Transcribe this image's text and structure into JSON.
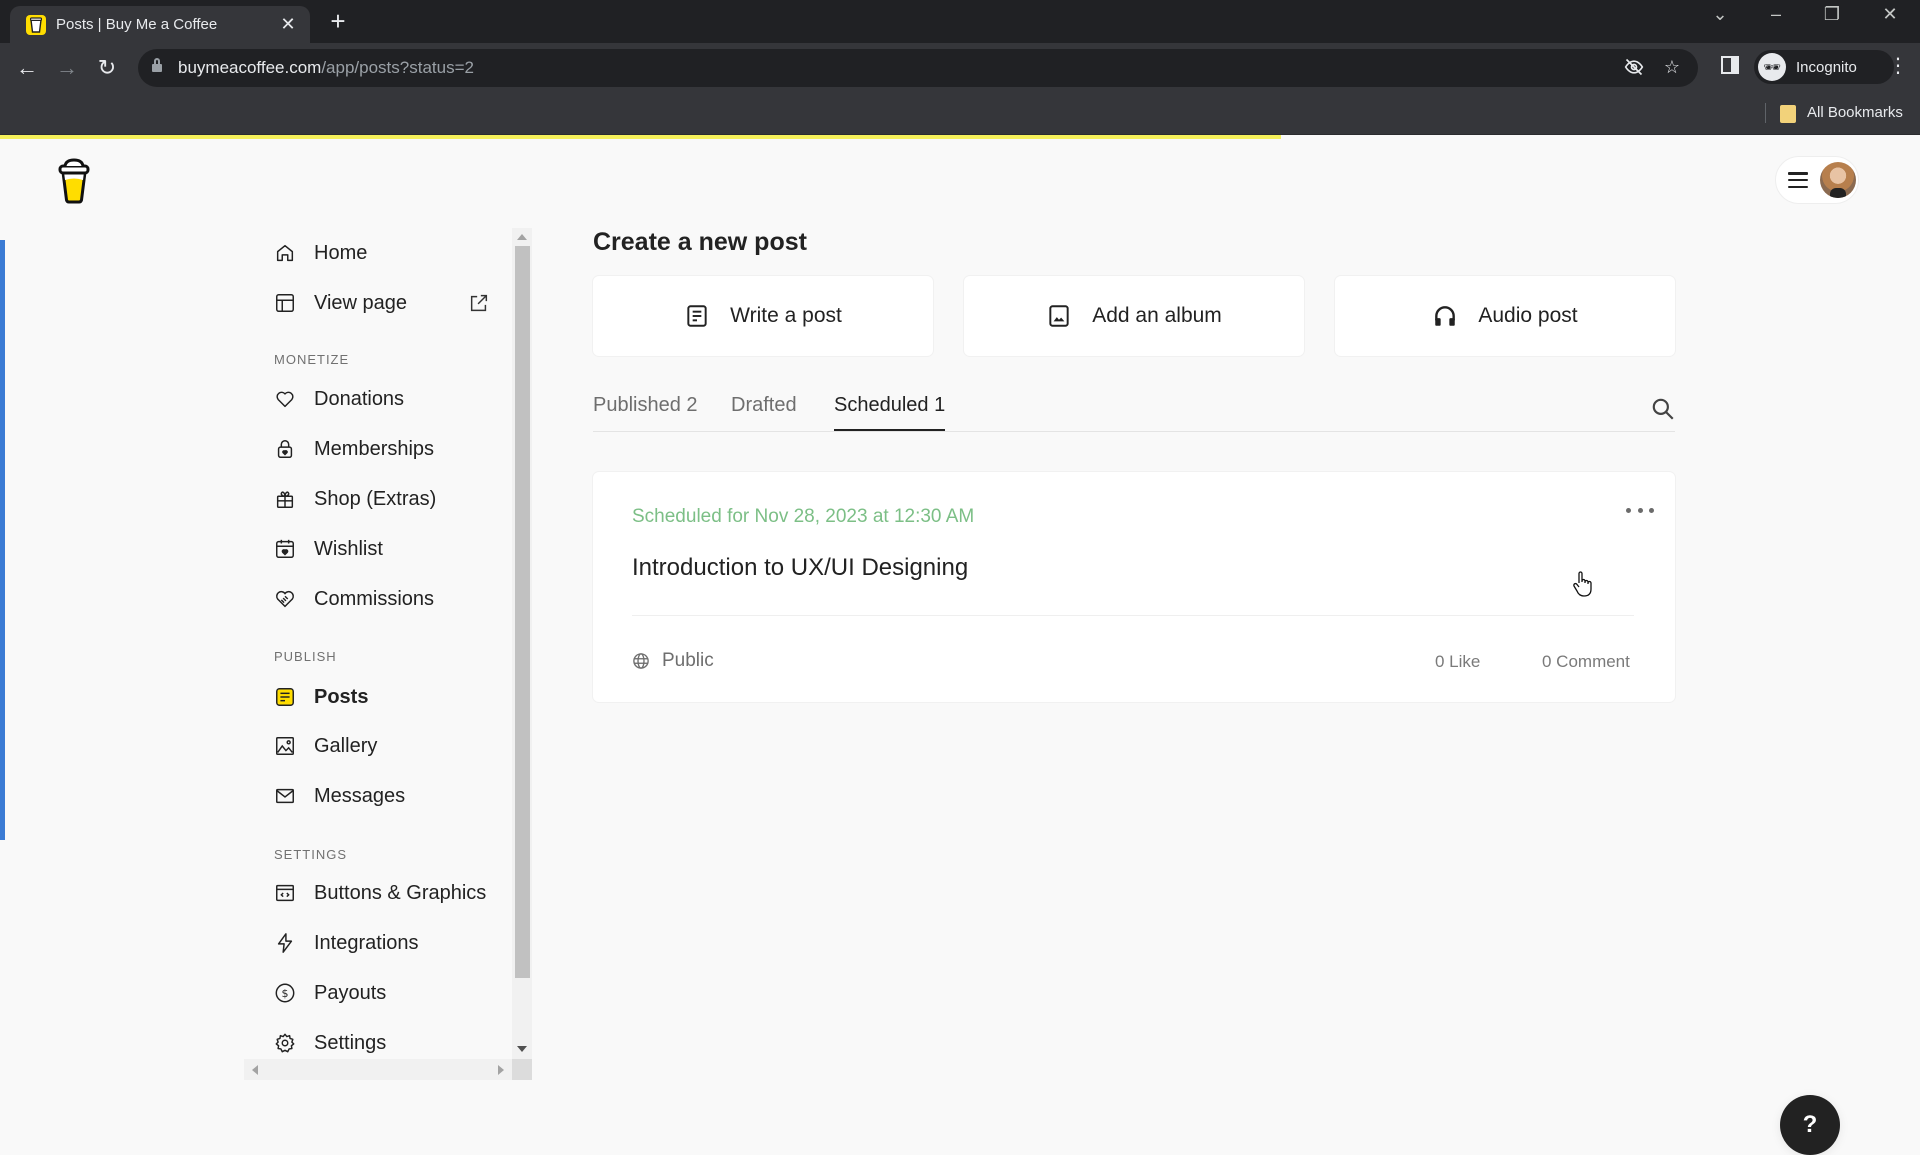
{
  "browser": {
    "tab_title": "Posts | Buy Me a Coffee",
    "url_host": "buymeacoffee.com",
    "url_path": "/app/posts?status=2",
    "profile_label": "Incognito",
    "bookmarks_label": "All Bookmarks",
    "page_load_progress_percent": 66.7
  },
  "sidebar": {
    "top_items": [
      {
        "label": "Home",
        "icon": "home-icon"
      },
      {
        "label": "View page",
        "icon": "layout-icon",
        "trailing_icon": "external-link-icon"
      }
    ],
    "sections": [
      {
        "title": "MONETIZE",
        "items": [
          {
            "label": "Donations",
            "icon": "heart-icon"
          },
          {
            "label": "Memberships",
            "icon": "lock-heart-icon"
          },
          {
            "label": "Shop (Extras)",
            "icon": "gift-icon"
          },
          {
            "label": "Wishlist",
            "icon": "calendar-heart-icon"
          },
          {
            "label": "Commissions",
            "icon": "handshake-icon"
          }
        ]
      },
      {
        "title": "PUBLISH",
        "items": [
          {
            "label": "Posts",
            "icon": "posts-icon",
            "active": true
          },
          {
            "label": "Gallery",
            "icon": "image-icon"
          },
          {
            "label": "Messages",
            "icon": "mail-icon"
          }
        ]
      },
      {
        "title": "SETTINGS",
        "items": [
          {
            "label": "Buttons & Graphics",
            "icon": "code-window-icon"
          },
          {
            "label": "Integrations",
            "icon": "lightning-icon"
          },
          {
            "label": "Payouts",
            "icon": "dollar-icon"
          },
          {
            "label": "Settings",
            "icon": "gear-icon"
          }
        ]
      }
    ]
  },
  "main": {
    "create_title": "Create a new post",
    "create_options": [
      {
        "label": "Write a post",
        "icon": "document-icon"
      },
      {
        "label": "Add an album",
        "icon": "image-icon"
      },
      {
        "label": "Audio post",
        "icon": "headphones-icon"
      }
    ],
    "tabs": [
      {
        "label": "Published 2",
        "active": false
      },
      {
        "label": "Drafted",
        "active": false
      },
      {
        "label": "Scheduled 1",
        "active": true
      }
    ],
    "posts": [
      {
        "scheduled_text": "Scheduled for Nov 28, 2023 at 12:30 AM",
        "title": "Introduction to UX/UI Designing",
        "visibility": "Public",
        "likes": "0 Like",
        "comments": "0 Comment"
      }
    ]
  },
  "help_label": "?",
  "colors": {
    "brand_yellow": "#FFDD00",
    "scheduled_green": "#7CBF86",
    "accent_blue": "#3B7BD4"
  }
}
